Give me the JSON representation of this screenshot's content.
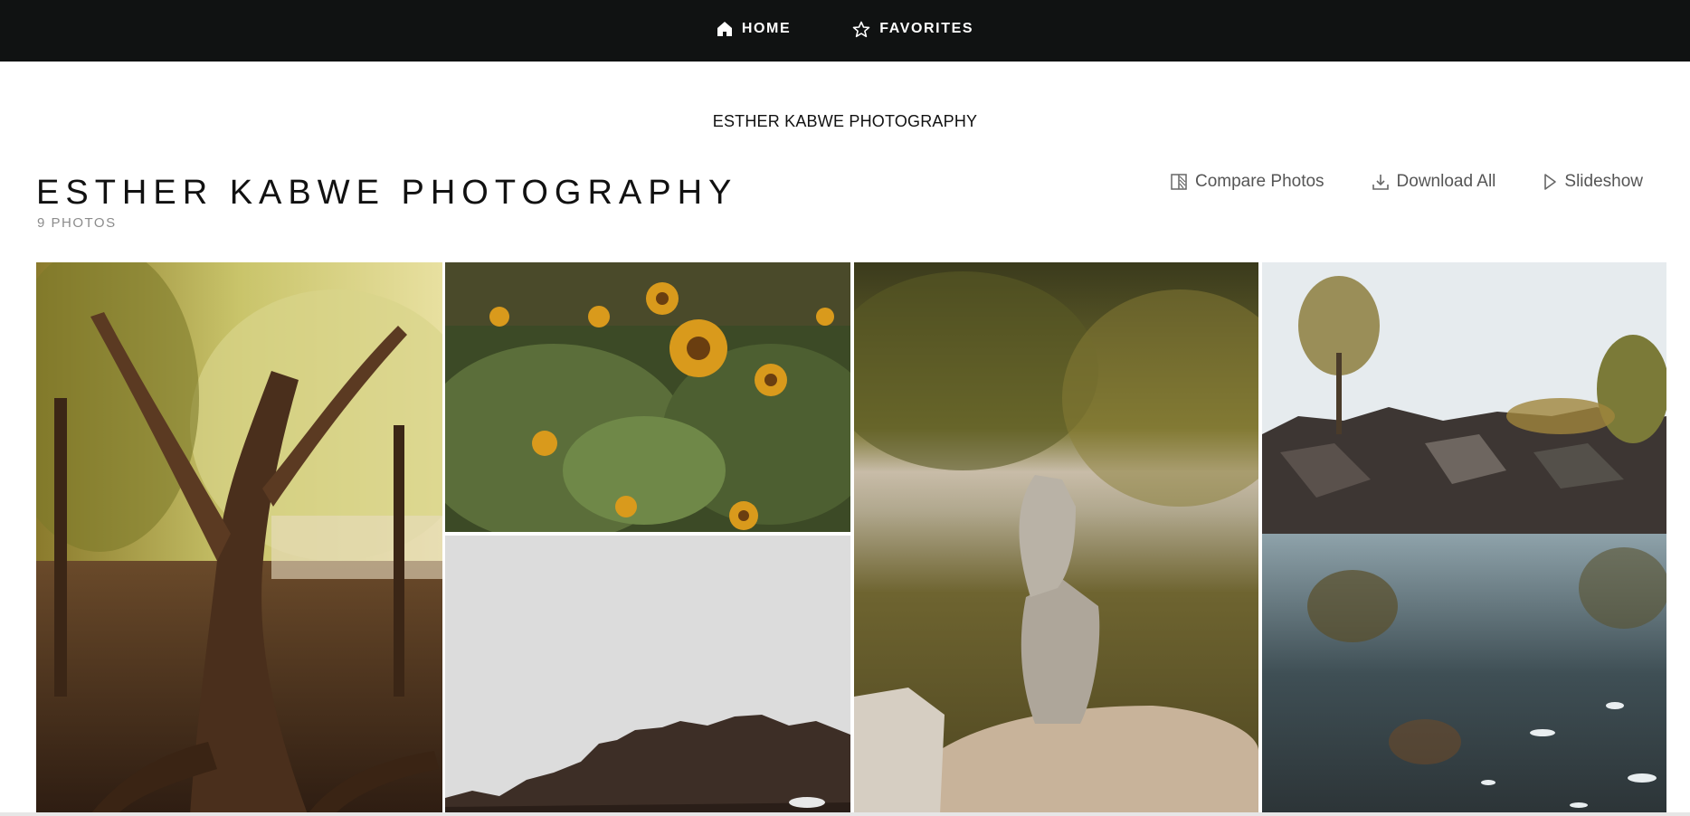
{
  "nav": {
    "home_label": "HOME",
    "home_icon": "home-icon",
    "favorites_label": "FAVORITES",
    "favorites_icon": "star-icon"
  },
  "site": {
    "title": "ESTHER KABWE PHOTOGRAPHY"
  },
  "gallery": {
    "title": "ESTHER KABWE PHOTOGRAPHY",
    "photo_count": "9 PHOTOS",
    "actions": {
      "compare_label": "Compare Photos",
      "compare_icon": "compare-icon",
      "download_label": "Download All",
      "download_icon": "download-icon",
      "slideshow_label": "Slideshow",
      "slideshow_icon": "play-icon"
    },
    "photos": [
      {
        "subject": "tree with exposed roots in sunlit forest"
      },
      {
        "subject": "sunflower field"
      },
      {
        "subject": "overcast sky above treeline"
      },
      {
        "subject": "balanced stacked rocks by water"
      },
      {
        "subject": "rocky pond reflecting trees"
      }
    ]
  },
  "colors": {
    "nav_background": "#101212",
    "nav_text": "#ffffff",
    "muted_text": "#8c8c8c",
    "action_text": "#555555"
  }
}
